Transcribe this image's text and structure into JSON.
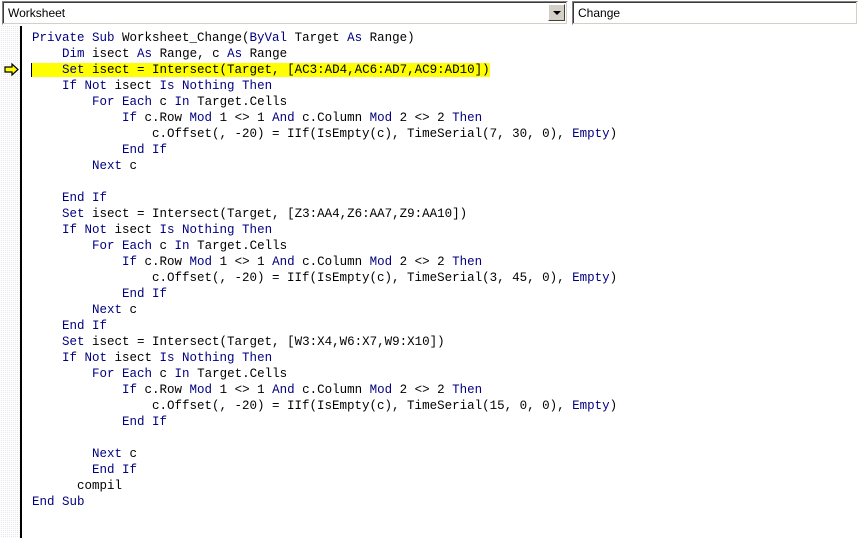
{
  "window": {
    "kind": "vba-code-editor"
  },
  "toolbar": {
    "object_combo": {
      "name": "object-dropdown",
      "value": "Worksheet",
      "arrow_icon": "chevron-down-icon"
    },
    "procedure_combo": {
      "name": "procedure-dropdown",
      "value": "Change",
      "arrow_icon": "chevron-down-icon"
    }
  },
  "margin": {
    "indicator_icon": "current-statement-arrow-icon",
    "indicator_line": 3,
    "indicator_color": "#ffff00"
  },
  "editor": {
    "caret_line": 3,
    "highlight_color": "#ffff00",
    "keyword_color": "#000080",
    "text_color": "#000000",
    "background_color": "#ffffff",
    "lines": [
      {
        "n": 1,
        "segments": [
          {
            "t": "kw",
            "s": "Private Sub "
          },
          {
            "t": "pl",
            "s": "Worksheet_Change("
          },
          {
            "t": "kw",
            "s": "ByVal "
          },
          {
            "t": "pl",
            "s": "Target "
          },
          {
            "t": "kw",
            "s": "As "
          },
          {
            "t": "pl",
            "s": "Range)"
          }
        ]
      },
      {
        "n": 2,
        "segments": [
          {
            "t": "pl",
            "s": "    "
          },
          {
            "t": "kw",
            "s": "Dim "
          },
          {
            "t": "pl",
            "s": "isect "
          },
          {
            "t": "kw",
            "s": "As "
          },
          {
            "t": "pl",
            "s": "Range, c "
          },
          {
            "t": "kw",
            "s": "As "
          },
          {
            "t": "pl",
            "s": "Range"
          }
        ]
      },
      {
        "n": 3,
        "highlight": true,
        "segments": [
          {
            "t": "pl",
            "s": "    "
          },
          {
            "t": "kw",
            "s": "Set "
          },
          {
            "t": "pl",
            "s": "isect = Intersect(Target, [AC3:AD4,AC6:AD7,AC9:AD10])"
          }
        ]
      },
      {
        "n": 4,
        "segments": [
          {
            "t": "pl",
            "s": "    "
          },
          {
            "t": "kw",
            "s": "If Not "
          },
          {
            "t": "pl",
            "s": "isect "
          },
          {
            "t": "kw",
            "s": "Is Nothing Then"
          }
        ]
      },
      {
        "n": 5,
        "segments": [
          {
            "t": "pl",
            "s": "        "
          },
          {
            "t": "kw",
            "s": "For Each "
          },
          {
            "t": "pl",
            "s": "c "
          },
          {
            "t": "kw",
            "s": "In "
          },
          {
            "t": "pl",
            "s": "Target.Cells"
          }
        ]
      },
      {
        "n": 6,
        "segments": [
          {
            "t": "pl",
            "s": "            "
          },
          {
            "t": "kw",
            "s": "If "
          },
          {
            "t": "pl",
            "s": "c.Row "
          },
          {
            "t": "kw",
            "s": "Mod "
          },
          {
            "t": "pl",
            "s": "1 <> 1 "
          },
          {
            "t": "kw",
            "s": "And "
          },
          {
            "t": "pl",
            "s": "c.Column "
          },
          {
            "t": "kw",
            "s": "Mod "
          },
          {
            "t": "pl",
            "s": "2 <> 2 "
          },
          {
            "t": "kw",
            "s": "Then"
          }
        ]
      },
      {
        "n": 7,
        "segments": [
          {
            "t": "pl",
            "s": "                c.Offset(, -20) = IIf(IsEmpty(c), TimeSerial(7, 30, 0), "
          },
          {
            "t": "kw",
            "s": "Empty"
          },
          {
            "t": "pl",
            "s": ")"
          }
        ]
      },
      {
        "n": 8,
        "segments": [
          {
            "t": "pl",
            "s": "            "
          },
          {
            "t": "kw",
            "s": "End If"
          }
        ]
      },
      {
        "n": 9,
        "segments": [
          {
            "t": "pl",
            "s": "        "
          },
          {
            "t": "kw",
            "s": "Next "
          },
          {
            "t": "pl",
            "s": "c"
          }
        ]
      },
      {
        "n": 10,
        "segments": [
          {
            "t": "pl",
            "s": ""
          }
        ]
      },
      {
        "n": 11,
        "segments": [
          {
            "t": "pl",
            "s": "    "
          },
          {
            "t": "kw",
            "s": "End If"
          }
        ]
      },
      {
        "n": 12,
        "segments": [
          {
            "t": "pl",
            "s": "    "
          },
          {
            "t": "kw",
            "s": "Set "
          },
          {
            "t": "pl",
            "s": "isect = Intersect(Target, [Z3:AA4,Z6:AA7,Z9:AA10])"
          }
        ]
      },
      {
        "n": 13,
        "segments": [
          {
            "t": "pl",
            "s": "    "
          },
          {
            "t": "kw",
            "s": "If Not "
          },
          {
            "t": "pl",
            "s": "isect "
          },
          {
            "t": "kw",
            "s": "Is Nothing Then"
          }
        ]
      },
      {
        "n": 14,
        "segments": [
          {
            "t": "pl",
            "s": "        "
          },
          {
            "t": "kw",
            "s": "For Each "
          },
          {
            "t": "pl",
            "s": "c "
          },
          {
            "t": "kw",
            "s": "In "
          },
          {
            "t": "pl",
            "s": "Target.Cells"
          }
        ]
      },
      {
        "n": 15,
        "segments": [
          {
            "t": "pl",
            "s": "            "
          },
          {
            "t": "kw",
            "s": "If "
          },
          {
            "t": "pl",
            "s": "c.Row "
          },
          {
            "t": "kw",
            "s": "Mod "
          },
          {
            "t": "pl",
            "s": "1 <> 1 "
          },
          {
            "t": "kw",
            "s": "And "
          },
          {
            "t": "pl",
            "s": "c.Column "
          },
          {
            "t": "kw",
            "s": "Mod "
          },
          {
            "t": "pl",
            "s": "2 <> 2 "
          },
          {
            "t": "kw",
            "s": "Then"
          }
        ]
      },
      {
        "n": 16,
        "segments": [
          {
            "t": "pl",
            "s": "                c.Offset(, -20) = IIf(IsEmpty(c), TimeSerial(3, 45, 0), "
          },
          {
            "t": "kw",
            "s": "Empty"
          },
          {
            "t": "pl",
            "s": ")"
          }
        ]
      },
      {
        "n": 17,
        "segments": [
          {
            "t": "pl",
            "s": "            "
          },
          {
            "t": "kw",
            "s": "End If"
          }
        ]
      },
      {
        "n": 18,
        "segments": [
          {
            "t": "pl",
            "s": "        "
          },
          {
            "t": "kw",
            "s": "Next "
          },
          {
            "t": "pl",
            "s": "c"
          }
        ]
      },
      {
        "n": 19,
        "segments": [
          {
            "t": "pl",
            "s": "    "
          },
          {
            "t": "kw",
            "s": "End If"
          }
        ]
      },
      {
        "n": 20,
        "segments": [
          {
            "t": "pl",
            "s": "    "
          },
          {
            "t": "kw",
            "s": "Set "
          },
          {
            "t": "pl",
            "s": "isect = Intersect(Target, [W3:X4,W6:X7,W9:X10])"
          }
        ]
      },
      {
        "n": 21,
        "segments": [
          {
            "t": "pl",
            "s": "    "
          },
          {
            "t": "kw",
            "s": "If Not "
          },
          {
            "t": "pl",
            "s": "isect "
          },
          {
            "t": "kw",
            "s": "Is Nothing Then"
          }
        ]
      },
      {
        "n": 22,
        "segments": [
          {
            "t": "pl",
            "s": "        "
          },
          {
            "t": "kw",
            "s": "For Each "
          },
          {
            "t": "pl",
            "s": "c "
          },
          {
            "t": "kw",
            "s": "In "
          },
          {
            "t": "pl",
            "s": "Target.Cells"
          }
        ]
      },
      {
        "n": 23,
        "segments": [
          {
            "t": "pl",
            "s": "            "
          },
          {
            "t": "kw",
            "s": "If "
          },
          {
            "t": "pl",
            "s": "c.Row "
          },
          {
            "t": "kw",
            "s": "Mod "
          },
          {
            "t": "pl",
            "s": "1 <> 1 "
          },
          {
            "t": "kw",
            "s": "And "
          },
          {
            "t": "pl",
            "s": "c.Column "
          },
          {
            "t": "kw",
            "s": "Mod "
          },
          {
            "t": "pl",
            "s": "2 <> 2 "
          },
          {
            "t": "kw",
            "s": "Then"
          }
        ]
      },
      {
        "n": 24,
        "segments": [
          {
            "t": "pl",
            "s": "                c.Offset(, -20) = IIf(IsEmpty(c), TimeSerial(15, 0, 0), "
          },
          {
            "t": "kw",
            "s": "Empty"
          },
          {
            "t": "pl",
            "s": ")"
          }
        ]
      },
      {
        "n": 25,
        "segments": [
          {
            "t": "pl",
            "s": "            "
          },
          {
            "t": "kw",
            "s": "End If"
          }
        ]
      },
      {
        "n": 26,
        "segments": [
          {
            "t": "pl",
            "s": ""
          }
        ]
      },
      {
        "n": 27,
        "segments": [
          {
            "t": "pl",
            "s": "        "
          },
          {
            "t": "kw",
            "s": "Next "
          },
          {
            "t": "pl",
            "s": "c"
          }
        ]
      },
      {
        "n": 28,
        "segments": [
          {
            "t": "pl",
            "s": "        "
          },
          {
            "t": "kw",
            "s": "End If"
          }
        ]
      },
      {
        "n": 29,
        "segments": [
          {
            "t": "pl",
            "s": "      compil"
          }
        ]
      },
      {
        "n": 30,
        "segments": [
          {
            "t": "kw",
            "s": "End Sub"
          }
        ]
      }
    ]
  }
}
